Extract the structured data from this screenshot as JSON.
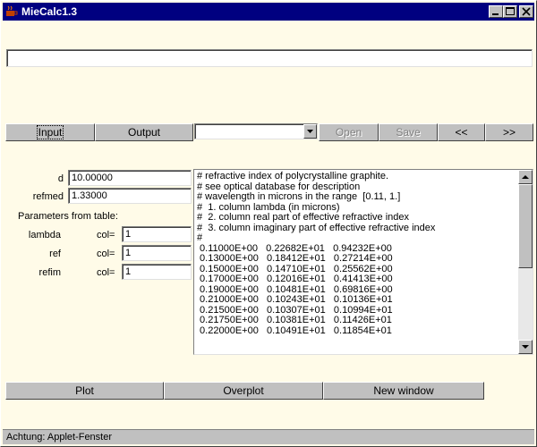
{
  "window": {
    "title": "MieCalc1.3"
  },
  "top_input": {
    "value": ""
  },
  "toolbar": {
    "input_label": "Input",
    "output_label": "Output",
    "file_select": {
      "value": ""
    },
    "open_label": "Open",
    "save_label": "Save",
    "prev_label": "<<",
    "next_label": ">>"
  },
  "params": {
    "d_label": "d",
    "d_value": "10.00000",
    "refmed_label": "refmed",
    "refmed_value": "1.33000",
    "table_heading": "Parameters from table:",
    "rows": [
      {
        "label": "lambda",
        "col_label": "col=",
        "value": "1"
      },
      {
        "label": "ref",
        "col_label": "col=",
        "value": "1"
      },
      {
        "label": "refim",
        "col_label": "col=",
        "value": "1"
      }
    ]
  },
  "text_area": {
    "lines": [
      "# refractive index of polycrystalline graphite.",
      "# see optical database for description",
      "# wavelength in microns in the range  [0.11, 1.]",
      "#  1. column lambda (in microns)",
      "#  2. column real part of effective refractive index",
      "#  3. column imaginary part of effective refractive index",
      "#",
      " 0.11000E+00   0.22682E+01   0.94232E+00",
      " 0.13000E+00   0.18412E+01   0.27214E+00",
      " 0.15000E+00   0.14710E+01   0.25562E+00",
      " 0.17000E+00   0.12016E+01   0.41413E+00",
      " 0.19000E+00   0.10481E+01   0.69816E+00",
      " 0.21000E+00   0.10243E+01   0.10136E+01",
      " 0.21500E+00   0.10307E+01   0.10994E+01",
      " 0.21750E+00   0.10381E+01   0.11426E+01",
      " 0.22000E+00   0.10491E+01   0.11854E+01"
    ]
  },
  "bottom_buttons": {
    "plot_label": "Plot",
    "overplot_label": "Overplot",
    "new_window_label": "New window"
  },
  "status_bar": {
    "text": "Achtung: Applet-Fenster"
  }
}
